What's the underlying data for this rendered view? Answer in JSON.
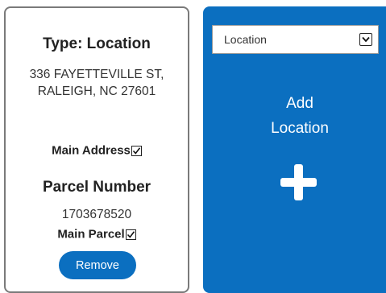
{
  "card": {
    "type_heading": "Type: Location",
    "address_line1": "336 FAYETTEVILLE ST,",
    "address_line2": "RALEIGH, NC 27601",
    "main_address_label": "Main Address",
    "main_address_checked": true,
    "parcel_heading": "Parcel Number",
    "parcel_number": "1703678520",
    "main_parcel_label": "Main Parcel",
    "main_parcel_checked": true,
    "remove_label": "Remove"
  },
  "add_panel": {
    "type_select_value": "Location",
    "add_label_line1": "Add",
    "add_label_line2": "Location",
    "background": "#0b6fc0",
    "plus_icon": "plus-icon",
    "dropdown_icon": "chevron-down-icon"
  }
}
